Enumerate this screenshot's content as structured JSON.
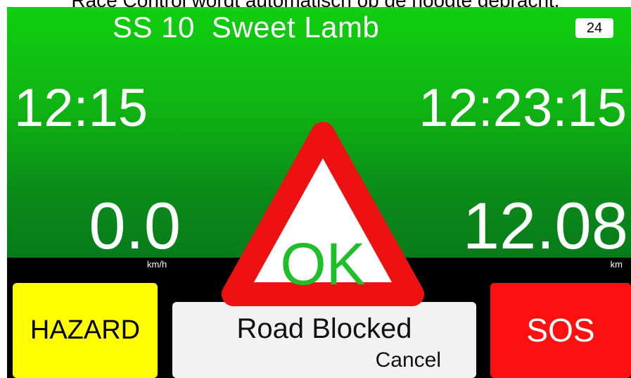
{
  "caption": "Race Control wordt automatisch op de hoogte gebracht.",
  "stage": {
    "number": "SS 10",
    "name": "Sweet Lamb"
  },
  "badge": "24",
  "times": {
    "left": "12:15",
    "right": "12:23:15"
  },
  "speed": {
    "value": "0.0",
    "unit": "km/h"
  },
  "distance": {
    "value": "12.08",
    "unit": "km"
  },
  "buttons": {
    "hazard": "HAZARD",
    "sos": "SOS",
    "road_blocked": "Road Blocked",
    "cancel": "Cancel"
  },
  "warning": {
    "text": "OK",
    "icon": "warning-triangle-icon"
  },
  "colors": {
    "hazard": "#ffff00",
    "sos": "#ff1010",
    "ok_text": "#1fbf2a",
    "triangle": "#ee1111",
    "top_green": "#10cf10"
  }
}
